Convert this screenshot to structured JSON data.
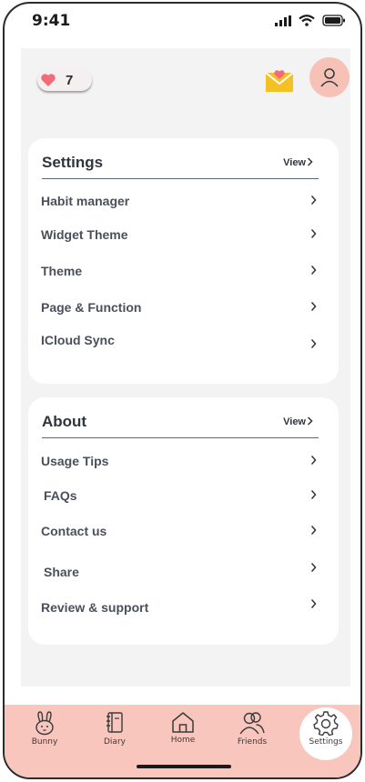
{
  "status_bar": {
    "time": "9:41",
    "icons": [
      "signal-icon",
      "wifi-icon",
      "battery-icon"
    ]
  },
  "header": {
    "likes_count": "7",
    "icons": [
      "heart-icon",
      "mail-heart-icon",
      "profile-icon"
    ]
  },
  "settings_card": {
    "title": "Settings",
    "view_label": "View",
    "items": [
      {
        "label": "Habit manager"
      },
      {
        "label": "Widget Theme"
      },
      {
        "label": "Theme"
      },
      {
        "label": "Page & Function"
      },
      {
        "label": "ICloud Sync"
      }
    ]
  },
  "about_card": {
    "title": "About",
    "view_label": "View",
    "items": [
      {
        "label": "Usage Tips"
      },
      {
        "label": "FAQs"
      },
      {
        "label": "Contact us"
      },
      {
        "label": "Share"
      },
      {
        "label": "Review & support"
      }
    ]
  },
  "tabbar": {
    "active": "Settings",
    "tabs": [
      {
        "label": "Bunny",
        "icon": "bunny-icon"
      },
      {
        "label": "Diary",
        "icon": "diary-icon"
      },
      {
        "label": "Home",
        "icon": "home-icon"
      },
      {
        "label": "Friends",
        "icon": "friends-icon"
      },
      {
        "label": "Settings",
        "icon": "gear-icon"
      }
    ]
  },
  "colors": {
    "accent_pink": "#f8c6bc",
    "avatar_bg": "#f6c2b7",
    "heart": "#f26b7a",
    "mail": "#f5c024",
    "page_bg": "#f3f3f3"
  }
}
